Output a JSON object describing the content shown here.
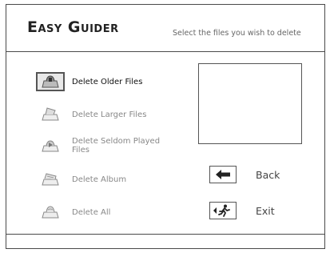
{
  "header": {
    "title": "Easy Guider",
    "subtitle": "Select the files you wish to delete"
  },
  "menu": {
    "items": [
      {
        "label": "Delete Older Files",
        "icon": "trash-older-icon",
        "selected": true
      },
      {
        "label": "Delete Larger Files",
        "icon": "trash-larger-icon",
        "selected": false
      },
      {
        "label": "Delete Seldom Played Files",
        "icon": "trash-seldom-icon",
        "selected": false
      },
      {
        "label": "Delete Album",
        "icon": "trash-album-icon",
        "selected": false
      },
      {
        "label": "Delete All",
        "icon": "trash-all-icon",
        "selected": false
      }
    ]
  },
  "navigation": {
    "back_label": "Back",
    "exit_label": "Exit"
  }
}
